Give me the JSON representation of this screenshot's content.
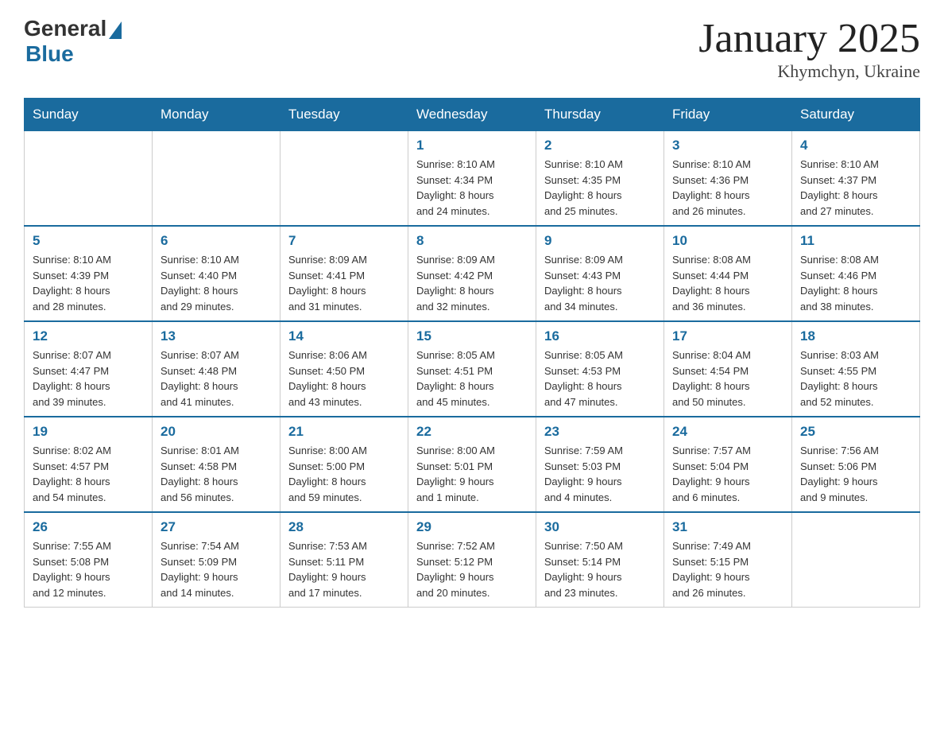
{
  "header": {
    "logo_general": "General",
    "logo_blue": "Blue",
    "title": "January 2025",
    "location": "Khymchyn, Ukraine"
  },
  "weekdays": [
    "Sunday",
    "Monday",
    "Tuesday",
    "Wednesday",
    "Thursday",
    "Friday",
    "Saturday"
  ],
  "weeks": [
    [
      {
        "day": "",
        "info": ""
      },
      {
        "day": "",
        "info": ""
      },
      {
        "day": "",
        "info": ""
      },
      {
        "day": "1",
        "info": "Sunrise: 8:10 AM\nSunset: 4:34 PM\nDaylight: 8 hours\nand 24 minutes."
      },
      {
        "day": "2",
        "info": "Sunrise: 8:10 AM\nSunset: 4:35 PM\nDaylight: 8 hours\nand 25 minutes."
      },
      {
        "day": "3",
        "info": "Sunrise: 8:10 AM\nSunset: 4:36 PM\nDaylight: 8 hours\nand 26 minutes."
      },
      {
        "day": "4",
        "info": "Sunrise: 8:10 AM\nSunset: 4:37 PM\nDaylight: 8 hours\nand 27 minutes."
      }
    ],
    [
      {
        "day": "5",
        "info": "Sunrise: 8:10 AM\nSunset: 4:39 PM\nDaylight: 8 hours\nand 28 minutes."
      },
      {
        "day": "6",
        "info": "Sunrise: 8:10 AM\nSunset: 4:40 PM\nDaylight: 8 hours\nand 29 minutes."
      },
      {
        "day": "7",
        "info": "Sunrise: 8:09 AM\nSunset: 4:41 PM\nDaylight: 8 hours\nand 31 minutes."
      },
      {
        "day": "8",
        "info": "Sunrise: 8:09 AM\nSunset: 4:42 PM\nDaylight: 8 hours\nand 32 minutes."
      },
      {
        "day": "9",
        "info": "Sunrise: 8:09 AM\nSunset: 4:43 PM\nDaylight: 8 hours\nand 34 minutes."
      },
      {
        "day": "10",
        "info": "Sunrise: 8:08 AM\nSunset: 4:44 PM\nDaylight: 8 hours\nand 36 minutes."
      },
      {
        "day": "11",
        "info": "Sunrise: 8:08 AM\nSunset: 4:46 PM\nDaylight: 8 hours\nand 38 minutes."
      }
    ],
    [
      {
        "day": "12",
        "info": "Sunrise: 8:07 AM\nSunset: 4:47 PM\nDaylight: 8 hours\nand 39 minutes."
      },
      {
        "day": "13",
        "info": "Sunrise: 8:07 AM\nSunset: 4:48 PM\nDaylight: 8 hours\nand 41 minutes."
      },
      {
        "day": "14",
        "info": "Sunrise: 8:06 AM\nSunset: 4:50 PM\nDaylight: 8 hours\nand 43 minutes."
      },
      {
        "day": "15",
        "info": "Sunrise: 8:05 AM\nSunset: 4:51 PM\nDaylight: 8 hours\nand 45 minutes."
      },
      {
        "day": "16",
        "info": "Sunrise: 8:05 AM\nSunset: 4:53 PM\nDaylight: 8 hours\nand 47 minutes."
      },
      {
        "day": "17",
        "info": "Sunrise: 8:04 AM\nSunset: 4:54 PM\nDaylight: 8 hours\nand 50 minutes."
      },
      {
        "day": "18",
        "info": "Sunrise: 8:03 AM\nSunset: 4:55 PM\nDaylight: 8 hours\nand 52 minutes."
      }
    ],
    [
      {
        "day": "19",
        "info": "Sunrise: 8:02 AM\nSunset: 4:57 PM\nDaylight: 8 hours\nand 54 minutes."
      },
      {
        "day": "20",
        "info": "Sunrise: 8:01 AM\nSunset: 4:58 PM\nDaylight: 8 hours\nand 56 minutes."
      },
      {
        "day": "21",
        "info": "Sunrise: 8:00 AM\nSunset: 5:00 PM\nDaylight: 8 hours\nand 59 minutes."
      },
      {
        "day": "22",
        "info": "Sunrise: 8:00 AM\nSunset: 5:01 PM\nDaylight: 9 hours\nand 1 minute."
      },
      {
        "day": "23",
        "info": "Sunrise: 7:59 AM\nSunset: 5:03 PM\nDaylight: 9 hours\nand 4 minutes."
      },
      {
        "day": "24",
        "info": "Sunrise: 7:57 AM\nSunset: 5:04 PM\nDaylight: 9 hours\nand 6 minutes."
      },
      {
        "day": "25",
        "info": "Sunrise: 7:56 AM\nSunset: 5:06 PM\nDaylight: 9 hours\nand 9 minutes."
      }
    ],
    [
      {
        "day": "26",
        "info": "Sunrise: 7:55 AM\nSunset: 5:08 PM\nDaylight: 9 hours\nand 12 minutes."
      },
      {
        "day": "27",
        "info": "Sunrise: 7:54 AM\nSunset: 5:09 PM\nDaylight: 9 hours\nand 14 minutes."
      },
      {
        "day": "28",
        "info": "Sunrise: 7:53 AM\nSunset: 5:11 PM\nDaylight: 9 hours\nand 17 minutes."
      },
      {
        "day": "29",
        "info": "Sunrise: 7:52 AM\nSunset: 5:12 PM\nDaylight: 9 hours\nand 20 minutes."
      },
      {
        "day": "30",
        "info": "Sunrise: 7:50 AM\nSunset: 5:14 PM\nDaylight: 9 hours\nand 23 minutes."
      },
      {
        "day": "31",
        "info": "Sunrise: 7:49 AM\nSunset: 5:15 PM\nDaylight: 9 hours\nand 26 minutes."
      },
      {
        "day": "",
        "info": ""
      }
    ]
  ]
}
